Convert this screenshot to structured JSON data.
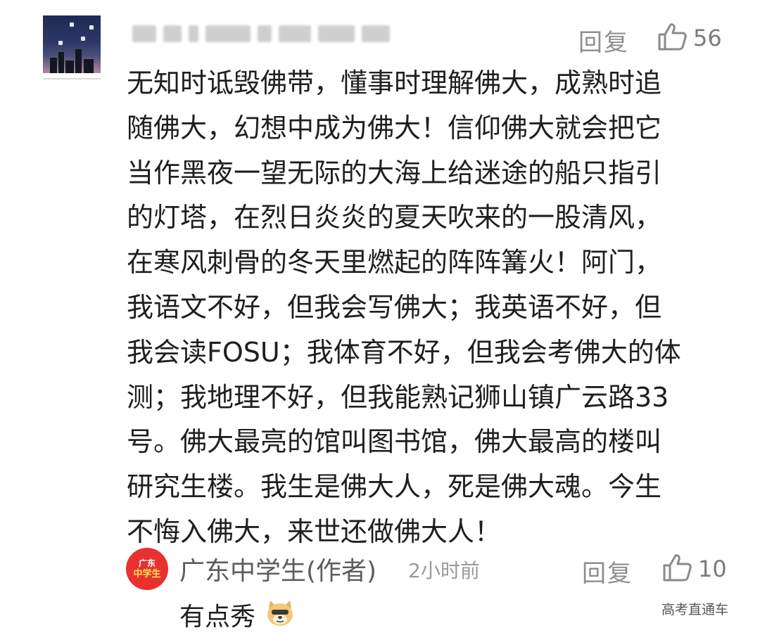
{
  "comment": {
    "reply_label": "回复",
    "like_count": "56",
    "thumb_icon": "thumbs-up-icon",
    "lines": [
      "无知时诋毁佛带，懂事时理解佛大，成熟时追",
      "随佛大，幻想中成为佛大！信仰佛大就会把它",
      "当作黑夜一望无际的大海上给迷途的船只指引",
      "的灯塔，在烈日炎炎的夏天吹来的一股清风，",
      "在寒风刺骨的冬天里燃起的阵阵篝火！阿门，",
      "我语文不好，但我会写佛大；我英语不好，但",
      "我会读FOSU；我体育不好，但我会考佛大的体",
      "测；我地理不好，但我能熟记狮山镇广云路33",
      "号。佛大最亮的馆叫图书馆，佛大最高的楼叫",
      "研究生楼。我生是佛大人，死是佛大魂。今生",
      "不悔入佛大，来世还做佛大人！"
    ]
  },
  "reply": {
    "avatar_line1": "广东",
    "avatar_line2": "中学生",
    "author": "广东中学生(作者)",
    "time": "2小时前",
    "reply_label": "回复",
    "like_count": "10",
    "text": "有点秀",
    "emoji_icon": "doge-emoji-icon"
  },
  "watermark": "高考直通车",
  "colors": {
    "reply_avatar_bg": "#e8312f",
    "meta_gray": "#8e8e8e",
    "text": "#1f1f1f"
  }
}
